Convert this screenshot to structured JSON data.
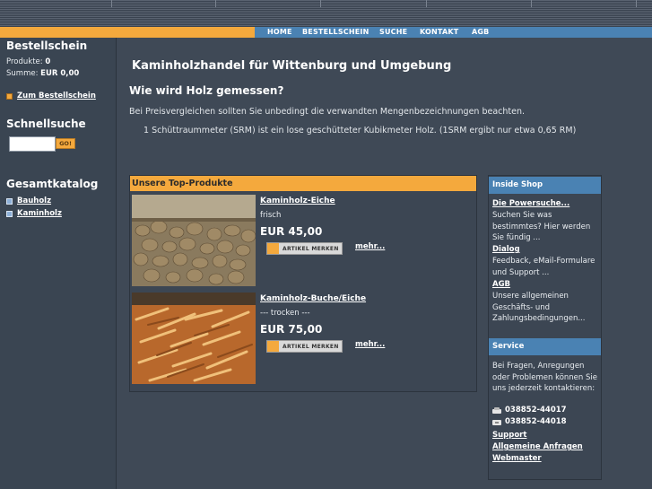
{
  "nav": {
    "items": [
      "HOME",
      "BESTELLSCHEIN",
      "SUCHE",
      "KONTAKT",
      "AGB"
    ]
  },
  "cart": {
    "title": "Bestellschein",
    "products_label": "Produkte:",
    "products_value": "0",
    "sum_label": "Summe:",
    "sum_value": "EUR 0,00",
    "link": "Zum Bestellschein"
  },
  "quicksearch": {
    "title": "Schnellsuche",
    "placeholder": "",
    "button": "GO!"
  },
  "catalog": {
    "title": "Gesamtkatalog",
    "items": [
      "Bauholz",
      "Kaminholz"
    ]
  },
  "main": {
    "title": "Kaminholzhandel für Wittenburg und Umgebung",
    "subtitle": "Wie wird Holz gemessen?",
    "intro": "Bei Preisvergleichen sollten Sie unbedingt die verwandten Mengenbezeichnungen beachten.",
    "srm": "1 Schüttraummeter (SRM) ist ein lose geschütteter Kubikmeter Holz. (1SRM ergibt nur etwa 0,65 RM)"
  },
  "top_products": {
    "title": "Unsere Top-Produkte",
    "items": [
      {
        "name": "Kaminholz-Eiche",
        "desc": "frisch",
        "price": "EUR 45,00",
        "button": "ARTIKEL MERKEN",
        "more": "mehr..."
      },
      {
        "name": "Kaminholz-Buche/Eiche",
        "desc": "--- trocken ---",
        "price": "EUR 75,00",
        "button": "ARTIKEL MERKEN",
        "more": "mehr..."
      }
    ]
  },
  "inside_shop": {
    "title": "Inside Shop",
    "powersearch_link": "Die Powersuche...",
    "powersearch_text": "Suchen Sie was bestimmtes? Hier werden Sie fündig ...",
    "dialog_link": "Dialog",
    "dialog_text": "Feedback, eMail-Formulare und Support ...",
    "agb_link": "AGB",
    "agb_text": "Unsere allgemeinen Geschäfts- und Zahlungsbedingungen..."
  },
  "service": {
    "title": "Service",
    "text": "Bei Fragen, Anregungen oder Problemen können Sie uns jederzeit kontaktieren:",
    "phone": "038852-44017",
    "fax": "038852-44018",
    "links": [
      "Support",
      "Allgemeine Anfragen",
      "Webmaster"
    ]
  },
  "colors": {
    "accent_orange": "#f4a93d",
    "nav_blue": "#4a82b3",
    "background": "#3f4956"
  }
}
